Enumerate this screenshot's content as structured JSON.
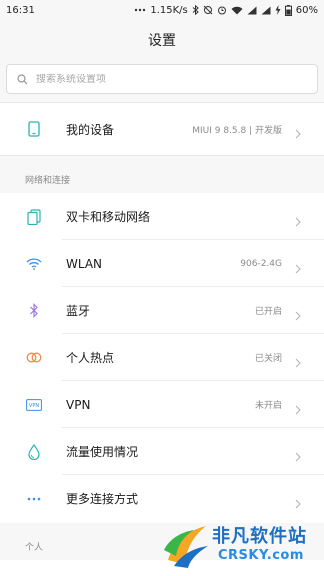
{
  "status_bar": {
    "time": "16:31",
    "speed": "1.15K/s",
    "battery": "60%"
  },
  "header": {
    "title": "设置"
  },
  "search": {
    "placeholder": "搜索系统设置项"
  },
  "device": {
    "label": "我的设备",
    "value": "MIUI 9 8.5.8 | 开发版",
    "icon": "phone-icon"
  },
  "network_section": {
    "header": "网络和连接",
    "items": [
      {
        "label": "双卡和移动网络",
        "value": "",
        "icon": "sim-card-icon"
      },
      {
        "label": "WLAN",
        "value": "906-2.4G",
        "icon": "wifi-icon"
      },
      {
        "label": "蓝牙",
        "value": "已开启",
        "icon": "bluetooth-icon"
      },
      {
        "label": "个人热点",
        "value": "已关闭",
        "icon": "hotspot-icon"
      },
      {
        "label": "VPN",
        "value": "未开启",
        "icon": "vpn-icon",
        "icon_text": "VPN"
      },
      {
        "label": "流量使用情况",
        "value": "",
        "icon": "data-usage-icon"
      },
      {
        "label": "更多连接方式",
        "value": "",
        "icon": "more-dots-icon"
      }
    ]
  },
  "personal_section": {
    "header": "个人"
  },
  "watermark": {
    "title": "非凡软件站",
    "subtitle": "CRSKY.com"
  },
  "colors": {
    "background": "#f7f7f7",
    "card": "#ffffff",
    "teal": "#2bb3b1",
    "blue": "#3a8ee6",
    "purple": "#9b7be0",
    "orange": "#f08a4b"
  }
}
